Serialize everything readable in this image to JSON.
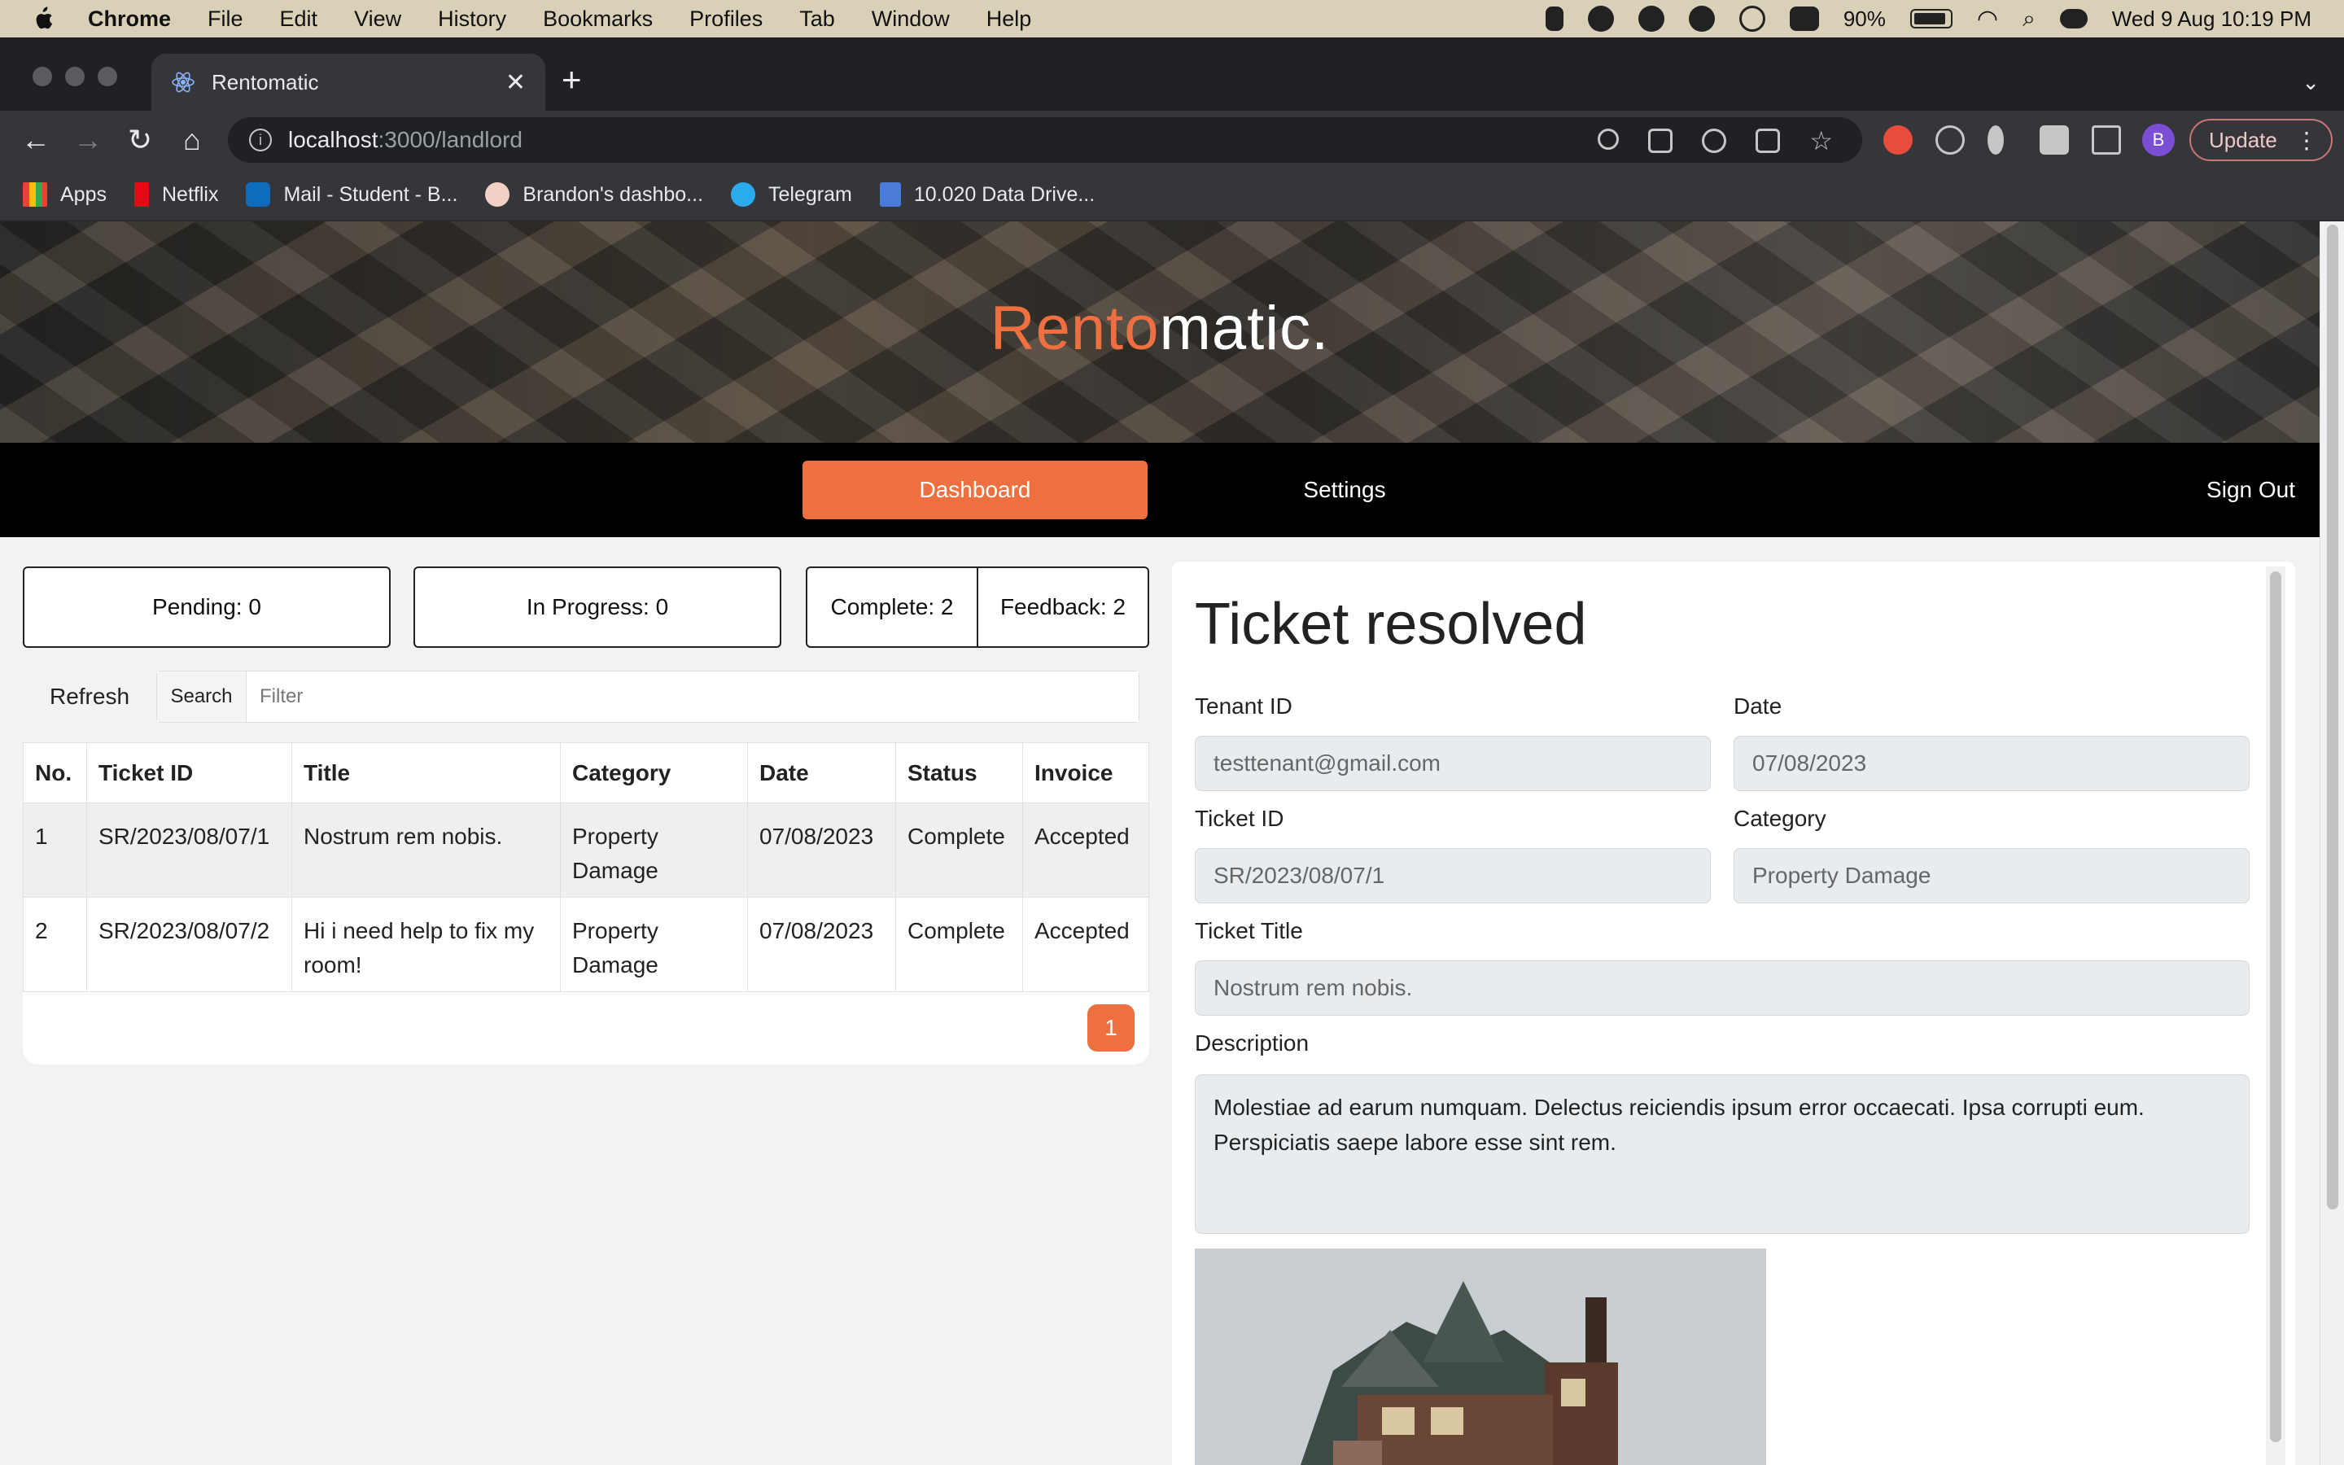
{
  "menubar": {
    "app_name": "Chrome",
    "items": [
      "File",
      "Edit",
      "View",
      "History",
      "Bookmarks",
      "Profiles",
      "Tab",
      "Window",
      "Help"
    ],
    "battery": "90%",
    "datetime": "Wed 9 Aug  10:19 PM"
  },
  "browser": {
    "tab_title": "Rentomatic",
    "url_host": "localhost",
    "url_path": ":3000/landlord",
    "update_label": "Update",
    "profile_initial": "B"
  },
  "bookmarks": [
    {
      "label": "Apps",
      "color": "#4285f4"
    },
    {
      "label": "Netflix",
      "color": "#e50914"
    },
    {
      "label": "Mail - Student - B...",
      "color": "#0f6cbd"
    },
    {
      "label": "Brandon's dashbo...",
      "color": "#f2d0c4"
    },
    {
      "label": "Telegram",
      "color": "#2aabee"
    },
    {
      "label": "10.020 Data Drive...",
      "color": "#4a7bd8"
    }
  ],
  "brand": {
    "accent": "Rento",
    "rest": "matic."
  },
  "nav": {
    "dashboard": "Dashboard",
    "settings": "Settings",
    "signout": "Sign Out"
  },
  "stats": {
    "pending": "Pending: 0",
    "in_progress": "In Progress: 0",
    "complete": "Complete: 2",
    "feedback": "Feedback: 2"
  },
  "controls": {
    "refresh": "Refresh",
    "search_label": "Search",
    "filter_placeholder": "Filter"
  },
  "table": {
    "headers": [
      "No.",
      "Ticket ID",
      "Title",
      "Category",
      "Date",
      "Status",
      "Invoice"
    ],
    "rows": [
      [
        "1",
        "SR/2023/08/07/1",
        "Nostrum rem nobis.",
        "Property Damage",
        "07/08/2023",
        "Complete",
        "Accepted"
      ],
      [
        "2",
        "SR/2023/08/07/2",
        "Hi i need help to fix my room!",
        "Property Damage",
        "07/08/2023",
        "Complete",
        "Accepted"
      ]
    ],
    "page": "1"
  },
  "detail": {
    "title": "Ticket resolved",
    "tenant_id_label": "Tenant ID",
    "tenant_id": "testtenant@gmail.com",
    "date_label": "Date",
    "date": "07/08/2023",
    "ticket_id_label": "Ticket ID",
    "ticket_id": "SR/2023/08/07/1",
    "category_label": "Category",
    "category": "Property Damage",
    "ticket_title_label": "Ticket Title",
    "ticket_title": "Nostrum rem nobis.",
    "description_label": "Description",
    "description": "Molestiae ad earum numquam. Delectus reiciendis ipsum error occaecati. Ipsa corrupti eum. Perspiciatis saepe labore esse sint rem."
  },
  "colors": {
    "accent": "#ee7040",
    "nav_bg": "#000000"
  }
}
